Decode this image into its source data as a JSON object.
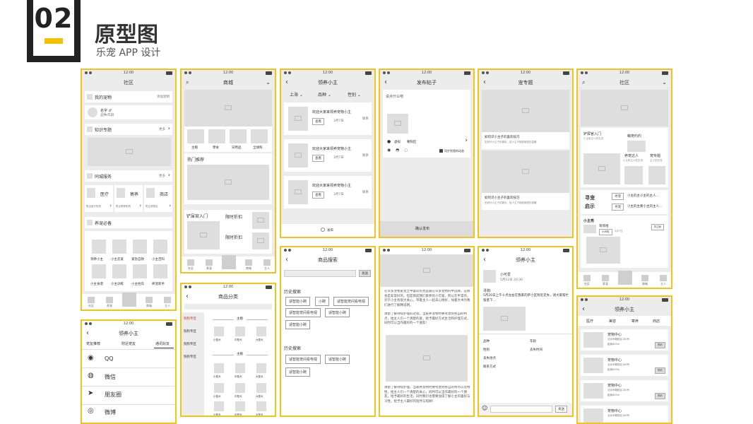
{
  "header": {
    "number": "02",
    "title": "原型图",
    "subtitle": "乐宠 APP 设计"
  },
  "status_time": "12:00",
  "screen1": {
    "title": "社区",
    "my_pet": "我的宠物",
    "add_pet": "添加宠物",
    "pet_name": "名字 ♂",
    "pet_sub": "品种/年龄",
    "topic": "知识专题",
    "more1": "更多",
    "service": "同城服务",
    "more2": "更多",
    "services": [
      "医疗",
      "寄养",
      "商店"
    ],
    "service_subs": [
      "附近医疗机构",
      "附近寄养机构",
      "附近宠物店"
    ],
    "must": "养宠必备",
    "must_items": [
      "领养小主",
      "小主恋爱",
      "紧急自救",
      "小主百科",
      "小主食谱",
      "小主训练",
      "小主姓氏",
      "养宠新手"
    ],
    "tabs": [
      "社区",
      "养宠",
      "",
      "商城",
      "主人"
    ]
  },
  "screen2": {
    "title": "商城",
    "cats": [
      "主粮",
      "零食",
      "日用品",
      "全球购"
    ],
    "hot": "热门推荐",
    "newbie": "铲屎官入门",
    "discount1": "限时折扣",
    "discount2": "限时折扣",
    "tabs": [
      "社区",
      "养宠",
      "",
      "商城",
      "主人"
    ]
  },
  "screen3": {
    "title": "领养小主",
    "filters": [
      "上海",
      "品种",
      "性别"
    ],
    "items": [
      {
        "title": "欢迎大家来领养宠物小主",
        "tag": "查看",
        "date": "3月7日",
        "side": "联系"
      },
      {
        "title": "欢迎大家来领养宠物小主",
        "tag": "查看",
        "date": "3月7日",
        "side": "联系"
      },
      {
        "title": "欢迎大家来领养宠物小主",
        "tag": "查看",
        "date": "3月7日",
        "side": "联系"
      }
    ],
    "publish": "发布"
  },
  "screen4": {
    "title": "发布帖子",
    "placeholder": "说点什么吧",
    "location": "虚拟",
    "district": "朝阳区",
    "sync": "同步到我的动态",
    "confirm": "确认发布"
  },
  "screen5": {
    "title": "宠专题",
    "article1": "如何识小主子的喜欢技巧",
    "article1_sub": "如何识小主子的喜欢，给小主子超越家庭的温暖",
    "article2": "如何识小主子的喜欢技巧",
    "article2_sub": "如何识小主子的喜欢，给小主子超越家庭的温暖"
  },
  "screen6": {
    "title": "社区",
    "newbie": "铲屎官入门",
    "newbie_sub": "小主和主人的交流",
    "find": "萌宠约约",
    "expert": "养宠达人",
    "expert_sub": "小主和主人的交流",
    "column": "宠专题",
    "column_sub": "主人的交流",
    "notice_l1": "寻宠",
    "notice_l2": "启示",
    "n1_tag": "寻宠",
    "n1_text": "小主的主小主的主人…",
    "n2_tag": "寻宠",
    "n2_text": "小主的主要小主的主人…",
    "show": "小主秀",
    "user": "哥哥哈",
    "user_tag": "小呵哈",
    "user_date": "3月7日",
    "follow": "关注我",
    "tabs": [
      "社区",
      "养宠",
      "",
      "商城",
      "主人"
    ]
  },
  "screen7": {
    "title": "商品搜索",
    "send": "发送",
    "history1": "历史搜索",
    "chips1": [
      "适智能小碗",
      "小碗",
      "适智能宠间看电视",
      "适智能宠间看电视",
      "适智能小碗",
      "适智能小碗"
    ],
    "history2": "历史搜索",
    "chips2": [
      "适智能宠间看电视",
      "适智能小碗",
      "适智能小碗"
    ]
  },
  "screen8": {
    "p1": "在众多宠物爱宠之中喜欢的也是最在众多宠物的中选择，这样会是非常好的，但是目前我们家养的小可爱，所以在平常的，对于小主有很大关心，带着主人一起去心情好，加着大书为我们进行了解释说明。",
    "p2": "清楚了解持续护理的过程，当家养宠物时要考虑到各自的特点，给主人们一个清楚的爱，给予最好方式生活和护理方式，同时可以当作最好的一个朋友！",
    "p3": "清楚了解持续护理，当家养宠物时要考虑到各自的特点以及特性，给主人们一个清楚的关心，同时可以当作最好的一个朋友，给予最好的生活，同时我们也需要加倍了解小主的喜好与习性，给予主人最好的陪伴与照顾！"
  },
  "screen9": {
    "title": "领养小主",
    "user": "小可爱",
    "date": "5月22日 20:30",
    "desc_label": "寻狗:",
    "desc": "5月20日上午十点左右在我家的萨小区附近走失，请大家帮忙留意下…",
    "fields": [
      "品种",
      "年龄",
      "性别",
      "丢失时间",
      "丢失地点",
      "联系方式"
    ],
    "send": "发送"
  },
  "screen10": {
    "title": "商品分类",
    "side": [
      "狗狗专区",
      "狗狗专区",
      "狗狗专区",
      "狗狗专区"
    ],
    "group1": "主粮",
    "group2": "主粮",
    "sizes": [
      "小型犬",
      "中型犬",
      "大型犬"
    ]
  },
  "screen11": {
    "title": "领养小主",
    "tabs": [
      "宠友推荐",
      "附近宠友",
      "通讯好友"
    ],
    "shares": [
      "QQ",
      "微信",
      "朋友圈",
      "微博"
    ]
  },
  "screen12": {
    "title": "领养小主",
    "tabs": [
      "医疗",
      "美容",
      "寄养",
      "商店"
    ],
    "items": [
      {
        "name": "宠物中心",
        "addr": "北京市朝阳区180号",
        "dist": "距离800m",
        "btn": "预约"
      },
      {
        "name": "宠物中心",
        "addr": "北京市朝阳区180号",
        "dist": "距离800m",
        "btn": "预约"
      },
      {
        "name": "宠物中心",
        "addr": "北京市朝阳区180号",
        "dist": "距离800m",
        "btn": "预约"
      },
      {
        "name": "宠物中心",
        "addr": "北京市朝阳区180号",
        "dist": "",
        "btn": ""
      }
    ]
  }
}
